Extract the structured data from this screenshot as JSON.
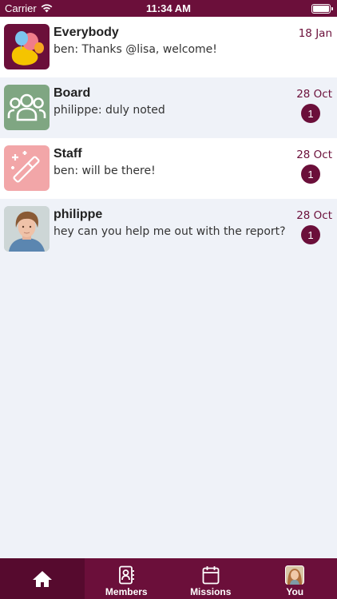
{
  "status_bar": {
    "carrier": "Carrier",
    "time": "11:34 AM",
    "battery_level": 1.0
  },
  "conversations": [
    {
      "name": "Everybody",
      "last_message": "ben: Thanks @lisa, welcome!",
      "date": "18 Jan",
      "unread": null,
      "avatar_icon": "balloons-icon"
    },
    {
      "name": "Board",
      "last_message": "philippe: duly noted",
      "date": "28 Oct",
      "unread": "1",
      "avatar_icon": "group-icon"
    },
    {
      "name": "Staff",
      "last_message": "ben: will be there!",
      "date": "28 Oct",
      "unread": "1",
      "avatar_icon": "magic-wand-icon"
    },
    {
      "name": "philippe",
      "last_message": "hey can you help me out with the report?",
      "date": "28 Oct",
      "unread": "1",
      "avatar_icon": "user-photo-avatar"
    }
  ],
  "tab_bar": {
    "tabs": [
      {
        "label": "",
        "icon": "home-icon",
        "active": true
      },
      {
        "label": "Members",
        "icon": "contacts-icon",
        "active": false
      },
      {
        "label": "Missions",
        "icon": "calendar-icon",
        "active": false
      },
      {
        "label": "You",
        "icon": "profile-photo-icon",
        "active": false
      }
    ]
  },
  "colors": {
    "brand": "#6b0f3a",
    "background": "#eff2f8",
    "board_avatar": "#7fa682",
    "staff_avatar": "#f2a6a8"
  }
}
